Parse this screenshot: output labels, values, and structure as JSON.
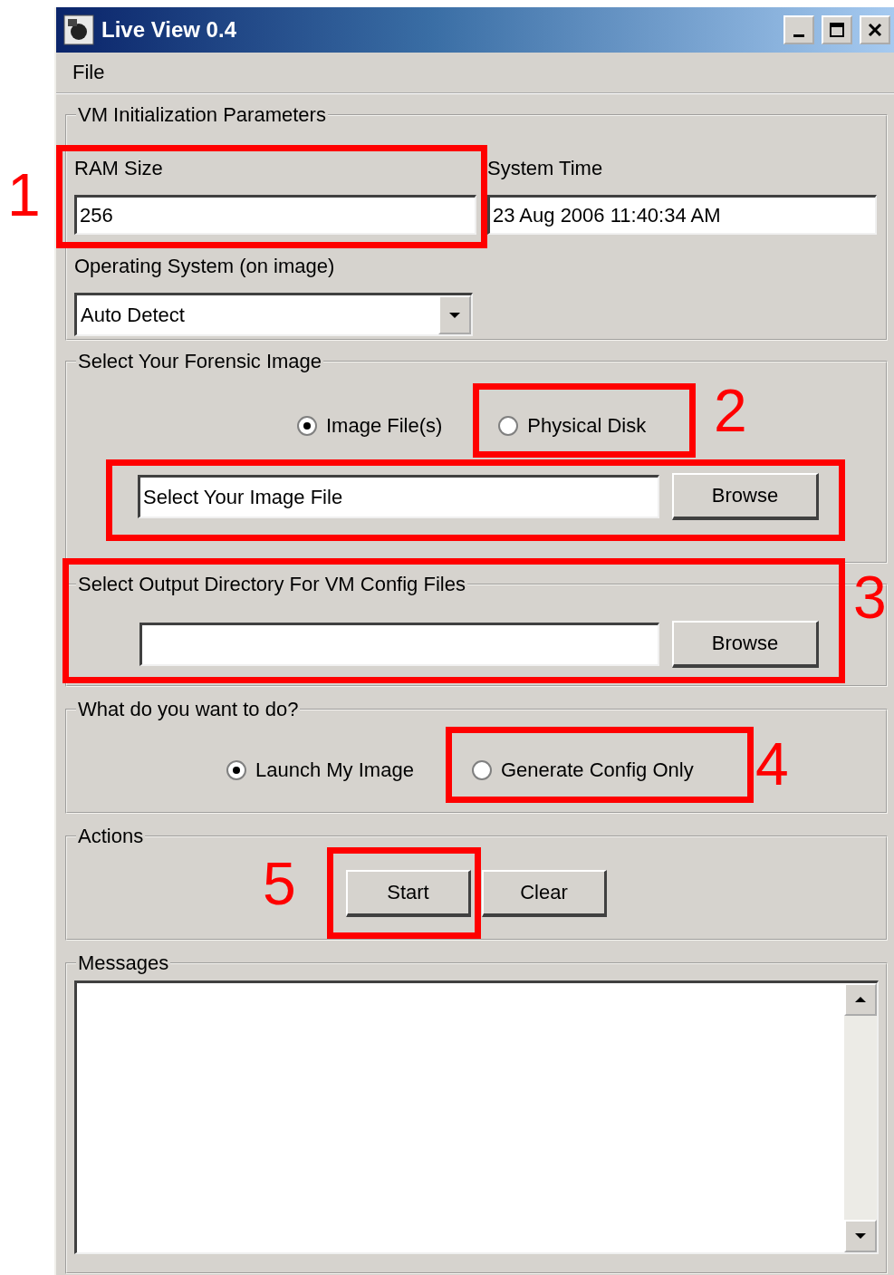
{
  "window": {
    "title": "Live View 0.4"
  },
  "menu": [
    {
      "label": "File"
    }
  ],
  "vm_parameters": {
    "title": "VM Initialization Parameters",
    "ram_size": {
      "label": "RAM Size",
      "value": "256"
    },
    "system_time": {
      "label": "System Time",
      "value": "23 Aug 2006 11:40:34 AM"
    },
    "operating_system": {
      "label": "Operating System (on image)",
      "value": "Auto Detect"
    }
  },
  "forensic_image": {
    "title": "Select Your Forensic Image",
    "options": [
      {
        "label": "Image File(s)",
        "selected": true
      },
      {
        "label": "Physical Disk",
        "selected": false
      }
    ],
    "image_file": {
      "value": "Select Your Image File"
    },
    "browse_button": "Browse"
  },
  "output_directory": {
    "title": "Select Output Directory For VM Config Files",
    "browse_button": "Browse"
  },
  "action_choice": {
    "title": "What do you want to do?",
    "options": [
      {
        "label": "Launch My Image",
        "selected": true
      },
      {
        "label": "Generate Config Only",
        "selected": false
      }
    ]
  },
  "actions": {
    "title": "Actions",
    "buttons": [
      "Start",
      "Clear"
    ]
  },
  "messages": {
    "title": "Messages"
  },
  "annotations": [
    {
      "number": "1"
    },
    {
      "number": "2"
    },
    {
      "number": "3"
    },
    {
      "number": "4"
    },
    {
      "number": "5"
    }
  ]
}
